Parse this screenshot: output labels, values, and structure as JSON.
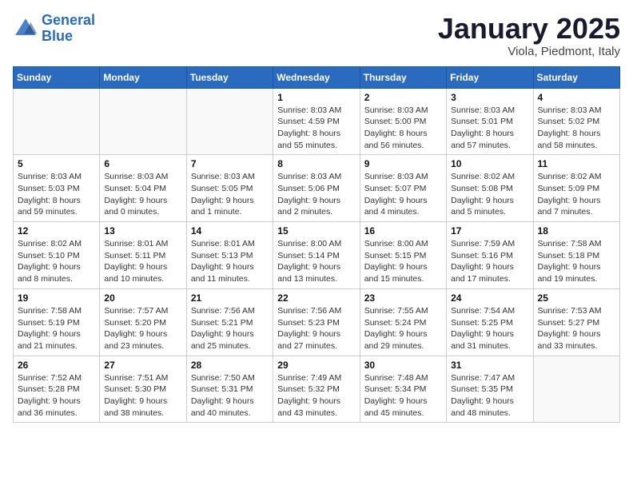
{
  "header": {
    "logo_line1": "General",
    "logo_line2": "Blue",
    "month_title": "January 2025",
    "subtitle": "Viola, Piedmont, Italy"
  },
  "weekdays": [
    "Sunday",
    "Monday",
    "Tuesday",
    "Wednesday",
    "Thursday",
    "Friday",
    "Saturday"
  ],
  "weeks": [
    [
      {
        "day": "",
        "info": ""
      },
      {
        "day": "",
        "info": ""
      },
      {
        "day": "",
        "info": ""
      },
      {
        "day": "1",
        "info": "Sunrise: 8:03 AM\nSunset: 4:59 PM\nDaylight: 8 hours\nand 55 minutes."
      },
      {
        "day": "2",
        "info": "Sunrise: 8:03 AM\nSunset: 5:00 PM\nDaylight: 8 hours\nand 56 minutes."
      },
      {
        "day": "3",
        "info": "Sunrise: 8:03 AM\nSunset: 5:01 PM\nDaylight: 8 hours\nand 57 minutes."
      },
      {
        "day": "4",
        "info": "Sunrise: 8:03 AM\nSunset: 5:02 PM\nDaylight: 8 hours\nand 58 minutes."
      }
    ],
    [
      {
        "day": "5",
        "info": "Sunrise: 8:03 AM\nSunset: 5:03 PM\nDaylight: 8 hours\nand 59 minutes."
      },
      {
        "day": "6",
        "info": "Sunrise: 8:03 AM\nSunset: 5:04 PM\nDaylight: 9 hours\nand 0 minutes."
      },
      {
        "day": "7",
        "info": "Sunrise: 8:03 AM\nSunset: 5:05 PM\nDaylight: 9 hours\nand 1 minute."
      },
      {
        "day": "8",
        "info": "Sunrise: 8:03 AM\nSunset: 5:06 PM\nDaylight: 9 hours\nand 2 minutes."
      },
      {
        "day": "9",
        "info": "Sunrise: 8:03 AM\nSunset: 5:07 PM\nDaylight: 9 hours\nand 4 minutes."
      },
      {
        "day": "10",
        "info": "Sunrise: 8:02 AM\nSunset: 5:08 PM\nDaylight: 9 hours\nand 5 minutes."
      },
      {
        "day": "11",
        "info": "Sunrise: 8:02 AM\nSunset: 5:09 PM\nDaylight: 9 hours\nand 7 minutes."
      }
    ],
    [
      {
        "day": "12",
        "info": "Sunrise: 8:02 AM\nSunset: 5:10 PM\nDaylight: 9 hours\nand 8 minutes."
      },
      {
        "day": "13",
        "info": "Sunrise: 8:01 AM\nSunset: 5:11 PM\nDaylight: 9 hours\nand 10 minutes."
      },
      {
        "day": "14",
        "info": "Sunrise: 8:01 AM\nSunset: 5:13 PM\nDaylight: 9 hours\nand 11 minutes."
      },
      {
        "day": "15",
        "info": "Sunrise: 8:00 AM\nSunset: 5:14 PM\nDaylight: 9 hours\nand 13 minutes."
      },
      {
        "day": "16",
        "info": "Sunrise: 8:00 AM\nSunset: 5:15 PM\nDaylight: 9 hours\nand 15 minutes."
      },
      {
        "day": "17",
        "info": "Sunrise: 7:59 AM\nSunset: 5:16 PM\nDaylight: 9 hours\nand 17 minutes."
      },
      {
        "day": "18",
        "info": "Sunrise: 7:58 AM\nSunset: 5:18 PM\nDaylight: 9 hours\nand 19 minutes."
      }
    ],
    [
      {
        "day": "19",
        "info": "Sunrise: 7:58 AM\nSunset: 5:19 PM\nDaylight: 9 hours\nand 21 minutes."
      },
      {
        "day": "20",
        "info": "Sunrise: 7:57 AM\nSunset: 5:20 PM\nDaylight: 9 hours\nand 23 minutes."
      },
      {
        "day": "21",
        "info": "Sunrise: 7:56 AM\nSunset: 5:21 PM\nDaylight: 9 hours\nand 25 minutes."
      },
      {
        "day": "22",
        "info": "Sunrise: 7:56 AM\nSunset: 5:23 PM\nDaylight: 9 hours\nand 27 minutes."
      },
      {
        "day": "23",
        "info": "Sunrise: 7:55 AM\nSunset: 5:24 PM\nDaylight: 9 hours\nand 29 minutes."
      },
      {
        "day": "24",
        "info": "Sunrise: 7:54 AM\nSunset: 5:25 PM\nDaylight: 9 hours\nand 31 minutes."
      },
      {
        "day": "25",
        "info": "Sunrise: 7:53 AM\nSunset: 5:27 PM\nDaylight: 9 hours\nand 33 minutes."
      }
    ],
    [
      {
        "day": "26",
        "info": "Sunrise: 7:52 AM\nSunset: 5:28 PM\nDaylight: 9 hours\nand 36 minutes."
      },
      {
        "day": "27",
        "info": "Sunrise: 7:51 AM\nSunset: 5:30 PM\nDaylight: 9 hours\nand 38 minutes."
      },
      {
        "day": "28",
        "info": "Sunrise: 7:50 AM\nSunset: 5:31 PM\nDaylight: 9 hours\nand 40 minutes."
      },
      {
        "day": "29",
        "info": "Sunrise: 7:49 AM\nSunset: 5:32 PM\nDaylight: 9 hours\nand 43 minutes."
      },
      {
        "day": "30",
        "info": "Sunrise: 7:48 AM\nSunset: 5:34 PM\nDaylight: 9 hours\nand 45 minutes."
      },
      {
        "day": "31",
        "info": "Sunrise: 7:47 AM\nSunset: 5:35 PM\nDaylight: 9 hours\nand 48 minutes."
      },
      {
        "day": "",
        "info": ""
      }
    ]
  ]
}
